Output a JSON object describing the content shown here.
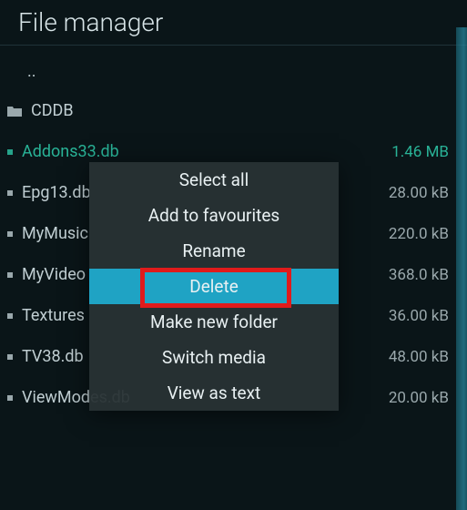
{
  "header": {
    "title": "File manager"
  },
  "parent_dir": "..",
  "files": [
    {
      "type": "folder",
      "name": "CDDB",
      "size": ""
    },
    {
      "type": "file",
      "name": "Addons33.db",
      "size": "1.46 MB",
      "highlighted": true
    },
    {
      "type": "file",
      "name": "Epg13.db",
      "size": "28.00 kB"
    },
    {
      "type": "file",
      "name": "MyMusic",
      "size": "220.0 kB",
      "truncated": true
    },
    {
      "type": "file",
      "name": "MyVideo",
      "size": "368.0 kB",
      "truncated": true
    },
    {
      "type": "file",
      "name": "Textures",
      "size": "36.00 kB",
      "truncated": true
    },
    {
      "type": "file",
      "name": "TV38.db",
      "size": "48.00 kB"
    },
    {
      "type": "file",
      "name": "ViewModes.db",
      "size": "20.00 kB",
      "truncated": true
    }
  ],
  "menu": {
    "items": [
      {
        "label": "Select all"
      },
      {
        "label": "Add to favourites"
      },
      {
        "label": "Rename"
      },
      {
        "label": "Delete",
        "selected": true
      },
      {
        "label": "Make new folder"
      },
      {
        "label": "Switch media"
      },
      {
        "label": "View as text"
      }
    ]
  }
}
